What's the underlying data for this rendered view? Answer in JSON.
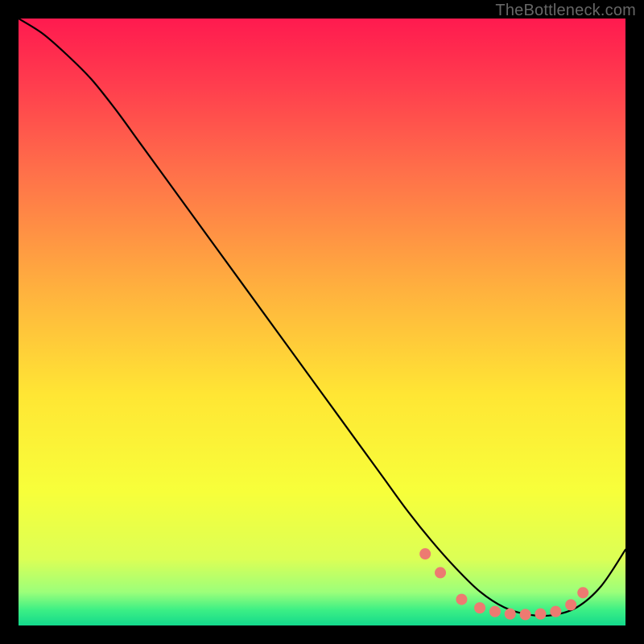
{
  "watermark": "TheBottleneck.com",
  "chart_data": {
    "type": "line",
    "title": "",
    "xlabel": "",
    "ylabel": "",
    "xlim": [
      0,
      100
    ],
    "ylim": [
      0,
      100
    ],
    "grid": false,
    "legend": false,
    "series": [
      {
        "name": "curve",
        "x": [
          0,
          4,
          8,
          12,
          16,
          20,
          24,
          28,
          32,
          36,
          40,
          44,
          48,
          52,
          56,
          60,
          64,
          68,
          72,
          76,
          80,
          84,
          88,
          92,
          96,
          100
        ],
        "y": [
          100,
          97.5,
          94,
          90,
          85,
          79.5,
          74,
          68.5,
          63,
          57.5,
          52,
          46.5,
          41,
          35.5,
          30,
          24.5,
          19,
          14,
          9.5,
          5.6,
          3.0,
          1.8,
          1.7,
          3.0,
          6.5,
          12.5
        ],
        "color": "#000000",
        "stroke_width": 2.2
      }
    ],
    "markers": {
      "name": "dots",
      "x": [
        67,
        69.5,
        73,
        76,
        78.5,
        81,
        83.5,
        86,
        88.5,
        91,
        93
      ],
      "y": [
        11.8,
        8.7,
        4.3,
        2.9,
        2.3,
        1.9,
        1.8,
        1.9,
        2.3,
        3.4,
        5.4
      ],
      "color": "#ED7A71",
      "radius": 7
    },
    "background_gradient": {
      "stops": [
        {
          "offset": 0.0,
          "color": "#FF1A4F"
        },
        {
          "offset": 0.1,
          "color": "#FF3A4E"
        },
        {
          "offset": 0.25,
          "color": "#FF6F4A"
        },
        {
          "offset": 0.45,
          "color": "#FFB23E"
        },
        {
          "offset": 0.62,
          "color": "#FFE634"
        },
        {
          "offset": 0.78,
          "color": "#F7FF3A"
        },
        {
          "offset": 0.89,
          "color": "#DCFF55"
        },
        {
          "offset": 0.945,
          "color": "#9CFF7A"
        },
        {
          "offset": 0.975,
          "color": "#3BEF85"
        },
        {
          "offset": 1.0,
          "color": "#13D98C"
        }
      ]
    }
  }
}
